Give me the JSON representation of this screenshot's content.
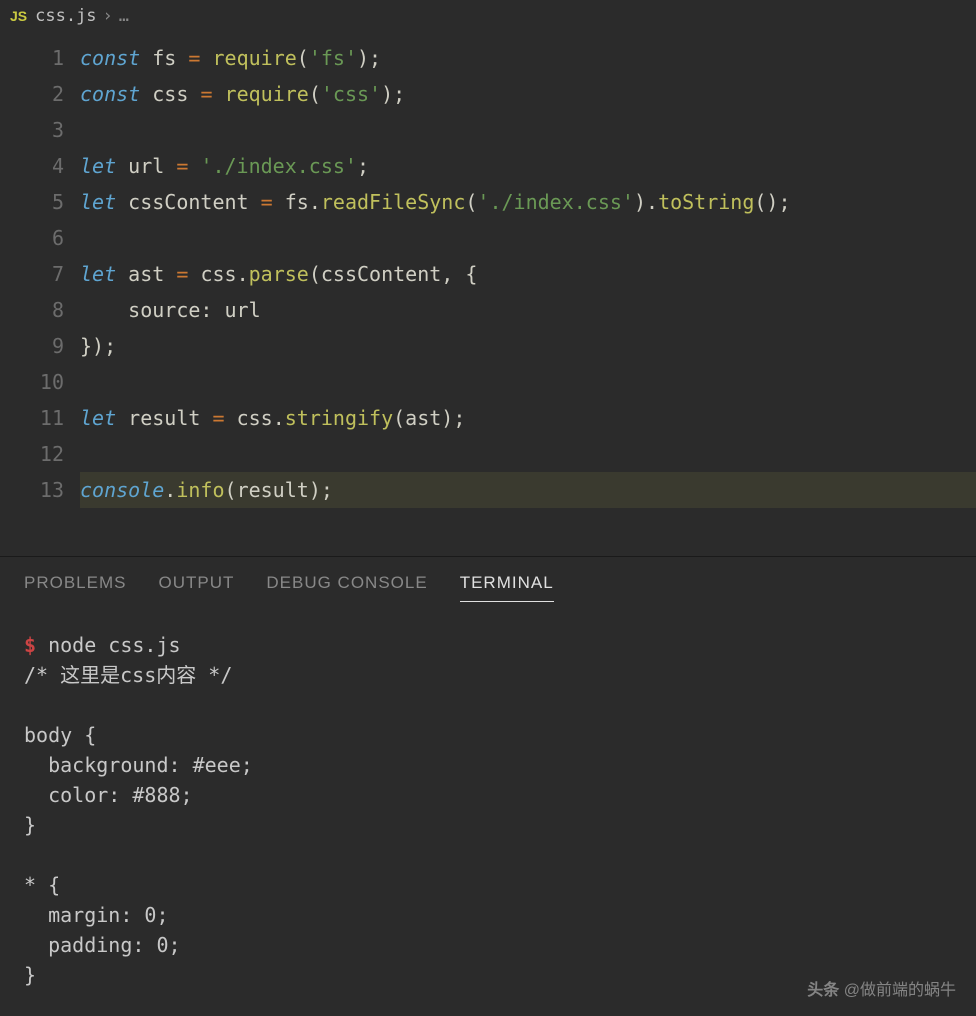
{
  "breadcrumb": {
    "icon_label": "JS",
    "filename": "css.js",
    "separator": "›",
    "ellipsis": "…"
  },
  "code": {
    "lines": [
      {
        "n": 1,
        "tokens": [
          {
            "c": "tk-keyword",
            "t": "const"
          },
          {
            "c": "",
            "t": " "
          },
          {
            "c": "tk-var",
            "t": "fs"
          },
          {
            "c": "",
            "t": " "
          },
          {
            "c": "tk-op",
            "t": "="
          },
          {
            "c": "",
            "t": " "
          },
          {
            "c": "tk-func",
            "t": "require"
          },
          {
            "c": "tk-punct",
            "t": "("
          },
          {
            "c": "tk-string",
            "t": "'fs'"
          },
          {
            "c": "tk-punct",
            "t": ");"
          }
        ]
      },
      {
        "n": 2,
        "tokens": [
          {
            "c": "tk-keyword",
            "t": "const"
          },
          {
            "c": "",
            "t": " "
          },
          {
            "c": "tk-var",
            "t": "css"
          },
          {
            "c": "",
            "t": " "
          },
          {
            "c": "tk-op",
            "t": "="
          },
          {
            "c": "",
            "t": " "
          },
          {
            "c": "tk-func",
            "t": "require"
          },
          {
            "c": "tk-punct",
            "t": "("
          },
          {
            "c": "tk-string",
            "t": "'css'"
          },
          {
            "c": "tk-punct",
            "t": ");"
          }
        ]
      },
      {
        "n": 3,
        "tokens": []
      },
      {
        "n": 4,
        "tokens": [
          {
            "c": "tk-keyword",
            "t": "let"
          },
          {
            "c": "",
            "t": " "
          },
          {
            "c": "tk-var",
            "t": "url"
          },
          {
            "c": "",
            "t": " "
          },
          {
            "c": "tk-op",
            "t": "="
          },
          {
            "c": "",
            "t": " "
          },
          {
            "c": "tk-string",
            "t": "'./index.css'"
          },
          {
            "c": "tk-punct",
            "t": ";"
          }
        ]
      },
      {
        "n": 5,
        "tokens": [
          {
            "c": "tk-keyword",
            "t": "let"
          },
          {
            "c": "",
            "t": " "
          },
          {
            "c": "tk-var",
            "t": "cssContent"
          },
          {
            "c": "",
            "t": " "
          },
          {
            "c": "tk-op",
            "t": "="
          },
          {
            "c": "",
            "t": " "
          },
          {
            "c": "tk-var",
            "t": "fs"
          },
          {
            "c": "tk-dot",
            "t": "."
          },
          {
            "c": "tk-method",
            "t": "readFileSync"
          },
          {
            "c": "tk-punct",
            "t": "("
          },
          {
            "c": "tk-string",
            "t": "'./index.css'"
          },
          {
            "c": "tk-punct",
            "t": ")."
          },
          {
            "c": "tk-method",
            "t": "toString"
          },
          {
            "c": "tk-punct",
            "t": "();"
          }
        ]
      },
      {
        "n": 6,
        "tokens": []
      },
      {
        "n": 7,
        "tokens": [
          {
            "c": "tk-keyword",
            "t": "let"
          },
          {
            "c": "",
            "t": " "
          },
          {
            "c": "tk-var",
            "t": "ast"
          },
          {
            "c": "",
            "t": " "
          },
          {
            "c": "tk-op",
            "t": "="
          },
          {
            "c": "",
            "t": " "
          },
          {
            "c": "tk-var",
            "t": "css"
          },
          {
            "c": "tk-dot",
            "t": "."
          },
          {
            "c": "tk-method",
            "t": "parse"
          },
          {
            "c": "tk-punct",
            "t": "("
          },
          {
            "c": "tk-var",
            "t": "cssContent"
          },
          {
            "c": "tk-punct",
            "t": ", {"
          }
        ]
      },
      {
        "n": 8,
        "tokens": [
          {
            "c": "",
            "t": "    "
          },
          {
            "c": "tk-prop",
            "t": "source"
          },
          {
            "c": "tk-punct",
            "t": ": "
          },
          {
            "c": "tk-var",
            "t": "url"
          }
        ]
      },
      {
        "n": 9,
        "tokens": [
          {
            "c": "tk-punct",
            "t": "});"
          }
        ]
      },
      {
        "n": 10,
        "tokens": []
      },
      {
        "n": 11,
        "tokens": [
          {
            "c": "tk-keyword",
            "t": "let"
          },
          {
            "c": "",
            "t": " "
          },
          {
            "c": "tk-var",
            "t": "result"
          },
          {
            "c": "",
            "t": " "
          },
          {
            "c": "tk-op",
            "t": "="
          },
          {
            "c": "",
            "t": " "
          },
          {
            "c": "tk-var",
            "t": "css"
          },
          {
            "c": "tk-dot",
            "t": "."
          },
          {
            "c": "tk-method",
            "t": "stringify"
          },
          {
            "c": "tk-punct",
            "t": "("
          },
          {
            "c": "tk-var",
            "t": "ast"
          },
          {
            "c": "tk-punct",
            "t": ");"
          }
        ]
      },
      {
        "n": 12,
        "tokens": []
      },
      {
        "n": 13,
        "highlight": true,
        "tokens": [
          {
            "c": "tk-console",
            "t": "console"
          },
          {
            "c": "tk-dot",
            "t": "."
          },
          {
            "c": "tk-method",
            "t": "info"
          },
          {
            "c": "tk-punct",
            "t": "("
          },
          {
            "c": "tk-var",
            "t": "result"
          },
          {
            "c": "tk-punct",
            "t": ");"
          }
        ]
      }
    ]
  },
  "panel": {
    "tabs": [
      {
        "label": "PROBLEMS",
        "active": false
      },
      {
        "label": "OUTPUT",
        "active": false
      },
      {
        "label": "DEBUG CONSOLE",
        "active": false
      },
      {
        "label": "TERMINAL",
        "active": true
      }
    ]
  },
  "terminal": {
    "prompt": "$",
    "command": "node css.js",
    "output": "/* 这里是css内容 */\n\nbody {\n  background: #eee;\n  color: #888;\n}\n\n* {\n  margin: 0;\n  padding: 0;\n}"
  },
  "watermark": {
    "prefix": "头条",
    "text": " @做前端的蜗牛"
  }
}
